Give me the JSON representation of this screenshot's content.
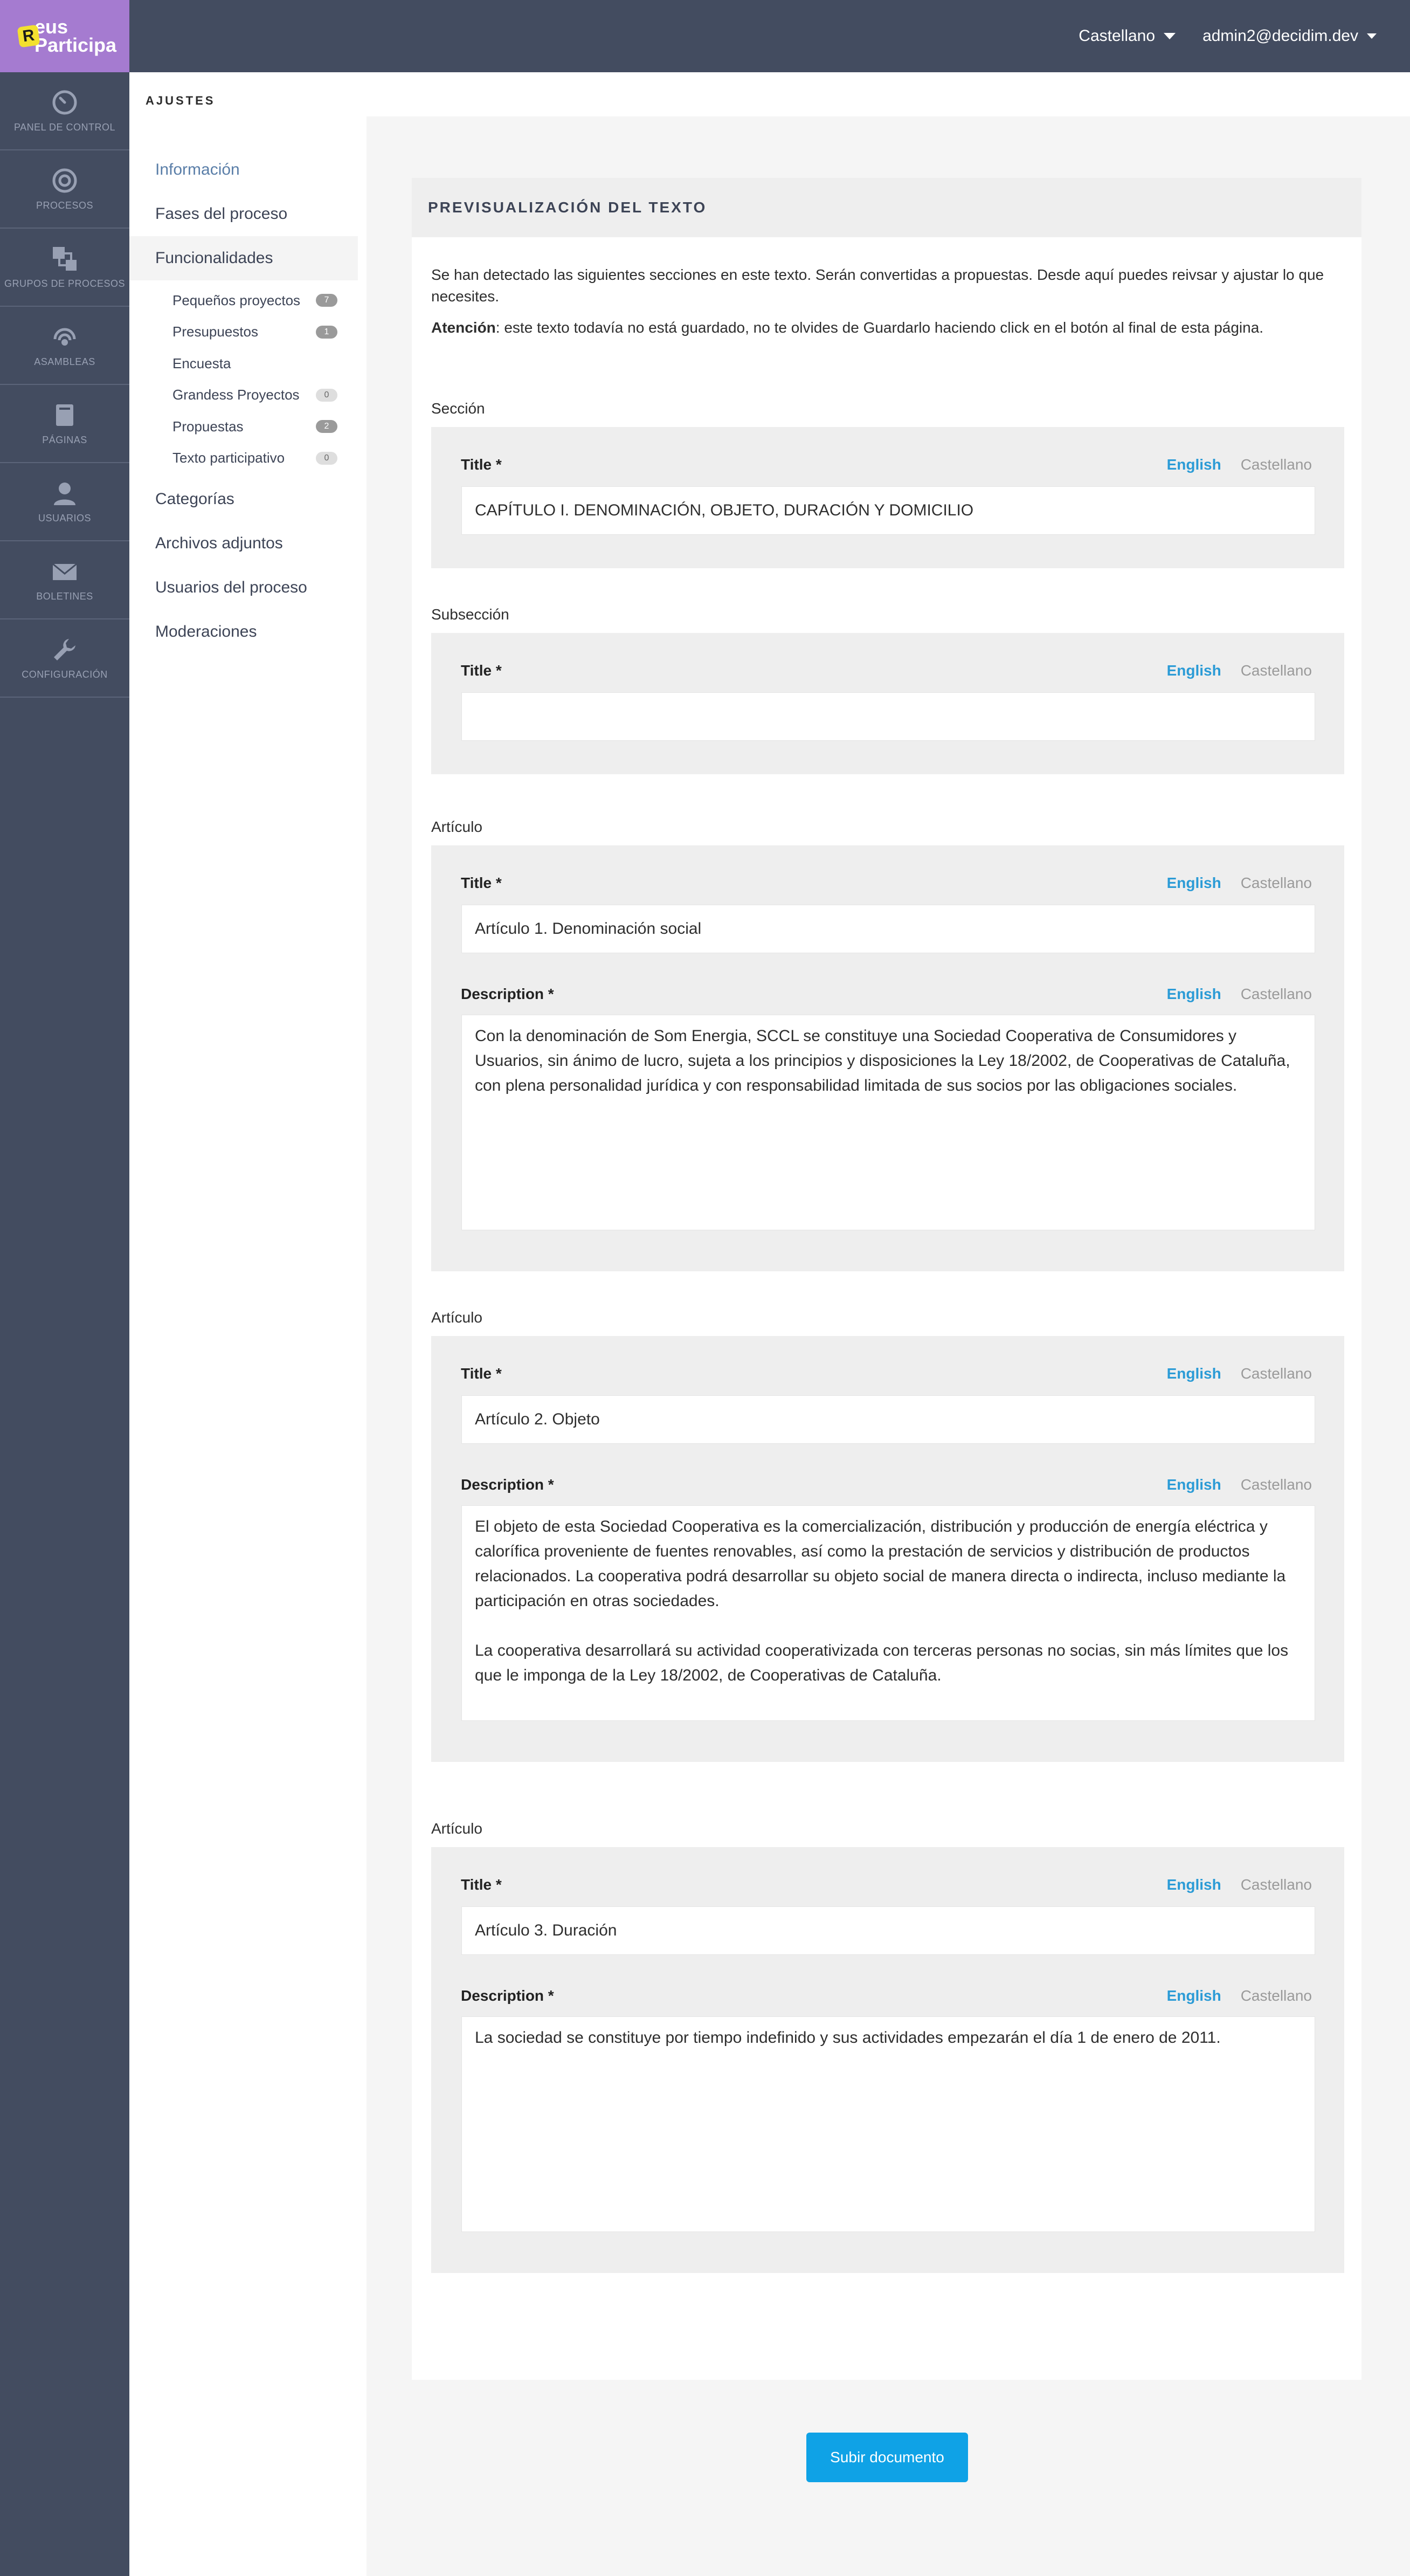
{
  "brand": {
    "badge": "R",
    "line1": "eus",
    "line2": "Participa"
  },
  "main_nav": [
    {
      "label": "PANEL DE CONTROL",
      "icon": "dashboard-icon"
    },
    {
      "label": "PROCESOS",
      "icon": "target-icon"
    },
    {
      "label": "GRUPOS DE PROCESOS",
      "icon": "squares-icon"
    },
    {
      "label": "ASAMBLEAS",
      "icon": "broadcast-icon"
    },
    {
      "label": "PÁGINAS",
      "icon": "book-icon"
    },
    {
      "label": "USUARIOS",
      "icon": "user-icon"
    },
    {
      "label": "BOLETINES",
      "icon": "envelope-icon"
    },
    {
      "label": "CONFIGURACIÓN",
      "icon": "wrench-icon"
    }
  ],
  "topbar": {
    "language": "Castellano",
    "user": "admin2@decidim.dev"
  },
  "secondary_nav": {
    "title": "AJUSTES",
    "items": [
      {
        "label": "Información"
      },
      {
        "label": "Fases del proceso"
      },
      {
        "label": "Funcionalidades"
      }
    ],
    "components": [
      {
        "label": "Pequeños proyectos",
        "count": "7"
      },
      {
        "label": "Presupuestos",
        "count": "1"
      },
      {
        "label": "Encuesta",
        "count": ""
      },
      {
        "label": "Grandess Proyectos",
        "count": "0"
      },
      {
        "label": "Propuestas",
        "count": "2"
      },
      {
        "label": "Texto participativo",
        "count": "0"
      }
    ],
    "items_after": [
      {
        "label": "Categorías"
      },
      {
        "label": "Archivos adjuntos"
      },
      {
        "label": "Usuarios del proceso"
      },
      {
        "label": "Moderaciones"
      }
    ]
  },
  "card": {
    "title": "PREVISUALIZACIÓN DEL TEXTO",
    "intro": "Se han detectado las siguientes secciones en este texto. Serán convertidas a propuestas. Desde aquí puedes reivsar y ajustar lo que necesites.",
    "warning_strong": "Atención",
    "warning_rest": ": este texto todavía no está guardado, no te olvides de Guardarlo haciendo click en el botón al final de esta página."
  },
  "lang_labels": {
    "en": "English",
    "es": "Castellano"
  },
  "field_labels": {
    "title": "Title *",
    "description": "Description *"
  },
  "sections": [
    {
      "type": "Sección",
      "title": "CAPÍTULO I. DENOMINACIÓN, OBJETO, DURACIÓN Y DOMICILIO"
    },
    {
      "type": "Subsección",
      "title": ""
    },
    {
      "type": "Artículo",
      "title": "Artículo 1. Denominación social",
      "description": [
        "Con la denominación de Som Energia, SCCL se constituye una Sociedad Cooperativa de Consumidores y Usuarios, sin ánimo de lucro, sujeta a los principios y disposiciones la Ley 18/2002, de Cooperativas de Cataluña, con plena personalidad jurídica y con responsabilidad limitada de sus socios por las obligaciones sociales."
      ]
    },
    {
      "type": "Artículo",
      "title": "Artículo 2. Objeto",
      "description": [
        "El objeto de esta Sociedad Cooperativa es la comercialización, distribución y producción de energía eléctrica y calorífica proveniente de fuentes renovables, así como la prestación de servicios y distribución de productos relacionados. La cooperativa podrá desarrollar su objeto social de manera directa o indirecta, incluso mediante la participación en otras sociedades.",
        "La cooperativa desarrollará su actividad cooperativizada con terceras personas no socias, sin más límites que los que le imponga de la Ley 18/2002, de Cooperativas de Cataluña."
      ]
    },
    {
      "type": "Artículo",
      "title": "Artículo 3. Duración",
      "description": [
        "La sociedad se constituye por tiempo indefinido y sus actividades empezarán el día 1 de enero de 2011."
      ]
    }
  ],
  "submit_label": "Subir documento",
  "colors": {
    "sidebar": "#434c60",
    "brand": "#a57bd0",
    "accent": "#0fa2e6"
  }
}
